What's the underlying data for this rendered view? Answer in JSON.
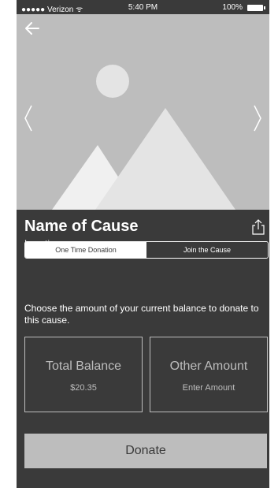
{
  "status_bar": {
    "carrier": "●●●●● Verizon ᯤ",
    "time": "5:40 PM",
    "battery": "100%"
  },
  "hero": {
    "back_icon": "back-arrow-icon",
    "prev_icon": "chevron-left-icon",
    "next_icon": "chevron-right-icon",
    "placeholder_icon": "image-placeholder-icon"
  },
  "cause": {
    "title": "Name of Cause",
    "location": "Location",
    "share_icon": "share-icon"
  },
  "tabs": {
    "one_time": "One Time Donation",
    "join": "Join the Cause",
    "selected": "One Time Donation"
  },
  "instructions": "Choose the amount of your current balance to donate to this cause.",
  "options": {
    "total": {
      "label": "Total Balance",
      "value": "$20.35"
    },
    "other": {
      "label": "Other Amount",
      "placeholder": "Enter Amount"
    }
  },
  "donate_label": "Donate",
  "colors": {
    "background": "#3a3a3a",
    "placeholder": "#bdbdbd",
    "text": "#ffffff"
  }
}
